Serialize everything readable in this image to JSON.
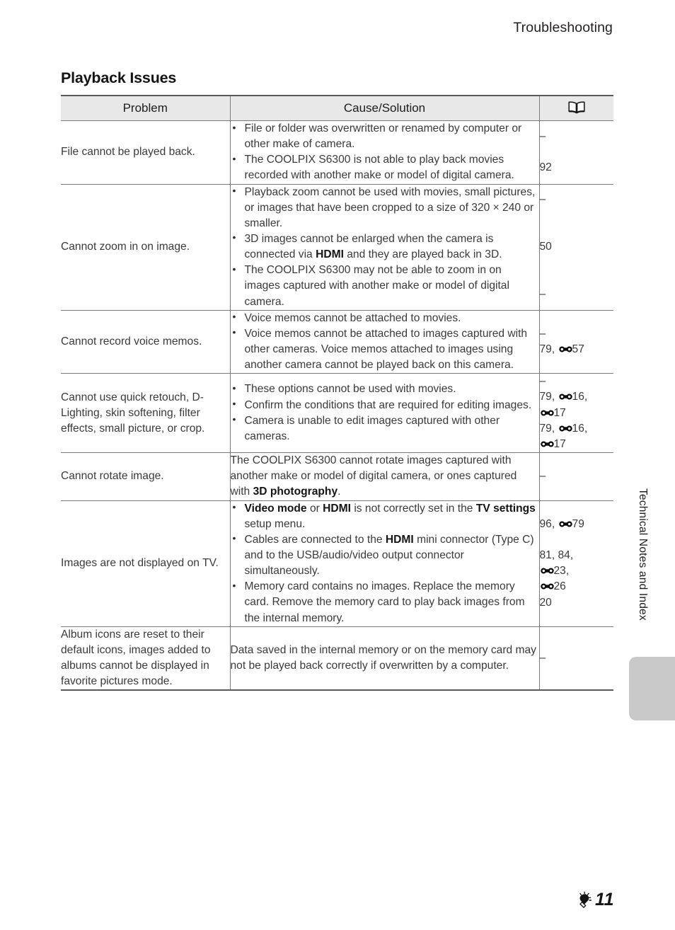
{
  "running_head": "Troubleshooting",
  "section_title": "Playback Issues",
  "table": {
    "headers": {
      "problem": "Problem",
      "cause_solution": "Cause/Solution",
      "reference_icon": "book-icon"
    },
    "rows": [
      {
        "problem": "File cannot be played back.",
        "bullets": [
          "File or folder was overwritten or renamed by computer or other make of camera.",
          "The COOLPIX S6300 is not able to play back movies recorded with another make or model of digital camera."
        ],
        "refs": [
          "–",
          "",
          "92"
        ]
      },
      {
        "problem": "Cannot zoom in on image.",
        "bullets": [
          "Playback zoom cannot be used with movies, small pictures, or images that have been cropped to a size of 320 × 240 or smaller.",
          "3D images cannot be enlarged when the camera is connected via HDMI and they are played back in 3D.",
          "The COOLPIX S6300 may not be able to zoom in on images captured with another make or model of digital camera."
        ],
        "refs": [
          "–",
          "",
          "",
          "50",
          "",
          "",
          "–"
        ]
      },
      {
        "problem": "Cannot record voice memos.",
        "bullets": [
          "Voice memos cannot be attached to movies.",
          "Voice memos cannot be attached to images captured with other cameras. Voice memos attached to images using another camera cannot be played back on this camera."
        ],
        "refs": [
          "–",
          "79, ⓐ57"
        ]
      },
      {
        "problem": "Cannot use quick retouch, D-Lighting, skin softening, filter effects, small picture, or crop.",
        "bullets": [
          "These options cannot be used with movies.",
          "Confirm the conditions that are required for editing images.",
          "Camera is unable to edit images captured with other cameras."
        ],
        "refs": [
          "–",
          "79, ⓐ16,",
          "ⓐ17",
          "79, ⓐ16,",
          "ⓐ17"
        ]
      },
      {
        "problem": "Cannot rotate image.",
        "paragraph": "The COOLPIX S6300 cannot rotate images captured with another make or model of digital camera, or ones captured with 3D photography.",
        "refs": [
          "–"
        ]
      },
      {
        "problem": "Images are not displayed on TV.",
        "bullets": [
          "Video mode or HDMI is not correctly set in the TV settings setup menu.",
          "Cables are connected to the HDMI mini connector (Type C) and to the USB/audio/video output connector simultaneously.",
          "Memory card contains no images. Replace the memory card. Remove the memory card to play back images from the internal memory."
        ],
        "refs": [
          "96, ⓐ79",
          "",
          "81, 84,",
          "ⓐ23,",
          "ⓐ26",
          "20"
        ]
      },
      {
        "problem": "Album icons are reset to their default icons, images added to albums cannot be displayed in favorite pictures mode.",
        "paragraph": "Data saved in the internal memory or on the memory card may not be played back correctly if overwritten by a computer.",
        "refs": [
          "–"
        ]
      }
    ]
  },
  "side_tab": {
    "label": "Technical Notes and Index"
  },
  "footer": {
    "icon": "lightbulb-icon",
    "page_number": "11"
  },
  "colors": {
    "header_fill": "#e8e8e8",
    "rule": "#7b7b7b",
    "heavy_rule": "#5a5a5a",
    "tab_gray": "#c9c9c9",
    "text": "#3a3a3a"
  }
}
